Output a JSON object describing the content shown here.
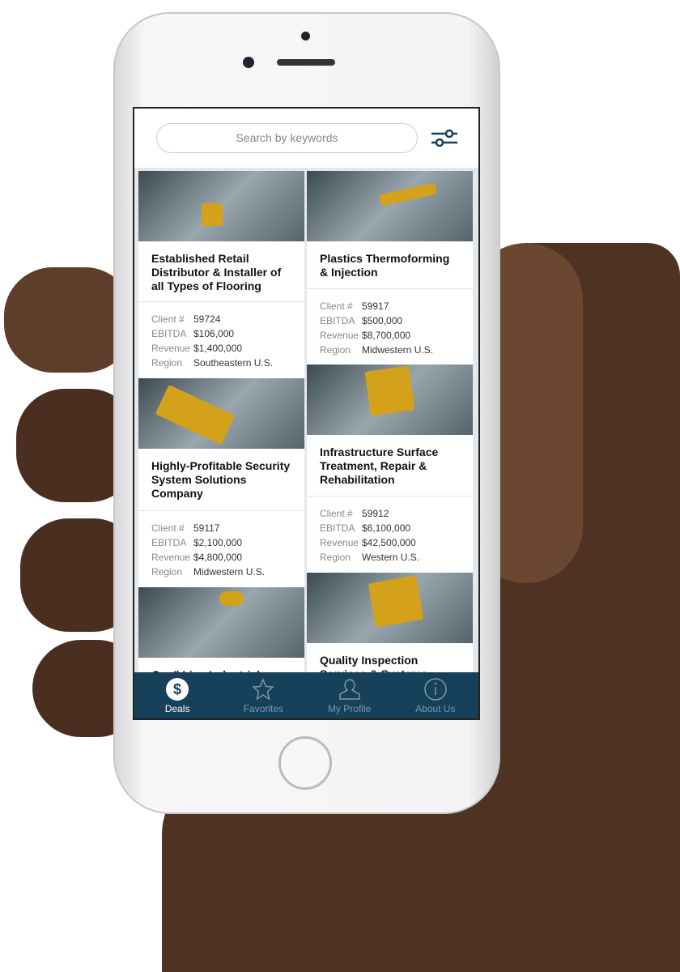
{
  "search": {
    "placeholder": "Search by keywords"
  },
  "labels": {
    "client": "Client #",
    "ebitda": "EBITDA",
    "revenue": "Revenue",
    "region": "Region"
  },
  "deals": [
    {
      "title": "Established Retail Distributor & Installer of all Types of Flooring",
      "client": "59724",
      "ebitda": "$106,000",
      "revenue": "$1,400,000",
      "region": "Southeastern U.S."
    },
    {
      "title": "Plastics Thermoforming & Injection",
      "client": "59917",
      "ebitda": "$500,000",
      "revenue": "$8,700,000",
      "region": "Midwestern U.S."
    },
    {
      "title": "Highly-Profitable Security System Solutions Company",
      "client": "59117",
      "ebitda": "$2,100,000",
      "revenue": "$4,800,000",
      "region": "Midwestern U.S."
    },
    {
      "title": "Infrastructure Surface Treatment, Repair & Rehabilitation",
      "client": "59912",
      "ebitda": "$6,100,000",
      "revenue": "$42,500,000",
      "region": "Western U.S."
    },
    {
      "title": "Gen'l Line Industrial"
    },
    {
      "title": "Quality Inspection Services & Systems"
    }
  ],
  "tabs": [
    {
      "label": "Deals",
      "icon": "dollar-icon",
      "active": true
    },
    {
      "label": "Favorites",
      "icon": "star-icon"
    },
    {
      "label": "My Profile",
      "icon": "user-icon"
    },
    {
      "label": "About Us",
      "icon": "info-icon"
    }
  ],
  "colors": {
    "tabbar": "#17415a",
    "accent": "#d4a21a"
  }
}
